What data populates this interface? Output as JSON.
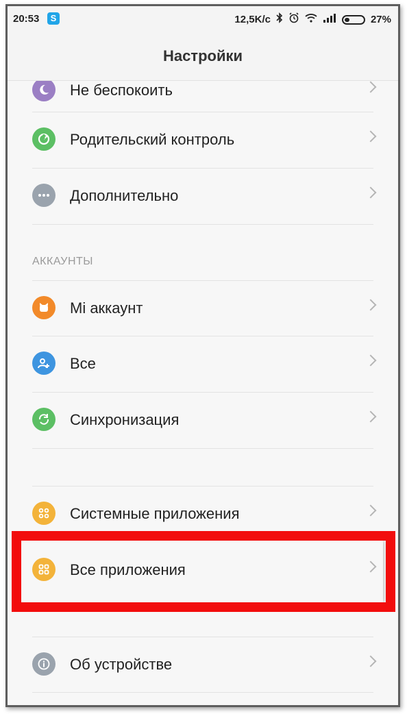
{
  "status_bar": {
    "time": "20:53",
    "network_speed": "12,5K/c",
    "battery": "27%",
    "battery_level": 0.27
  },
  "header": {
    "title": "Настройки"
  },
  "items": [
    {
      "label": "Не беспокоить",
      "icon": "moon-icon",
      "color": "#9b7fc4"
    },
    {
      "label": "Родительский контроль",
      "icon": "parental-control-icon",
      "color": "#5cbf64"
    },
    {
      "label": "Дополнительно",
      "icon": "more-dots-icon",
      "color": "#9aa3ad"
    }
  ],
  "section_accounts": "АККАУНТЫ",
  "accounts": [
    {
      "label": "Mi аккаунт",
      "icon": "mi-account-icon",
      "color": "#f28a2a"
    },
    {
      "label": "Все",
      "icon": "add-user-icon",
      "color": "#3e95e0"
    },
    {
      "label": "Синхронизация",
      "icon": "sync-icon",
      "color": "#5cbf64"
    }
  ],
  "apps": [
    {
      "label": "Системные приложения",
      "icon": "apps-grid-icon",
      "color": "#f3b33a"
    },
    {
      "label": "Все приложения",
      "icon": "apps-grid-icon",
      "color": "#f3b33a"
    }
  ],
  "about": {
    "label": "Об устройстве",
    "icon": "info-icon",
    "color": "#9aa3ad"
  },
  "highlight_color": "#f20d0d"
}
